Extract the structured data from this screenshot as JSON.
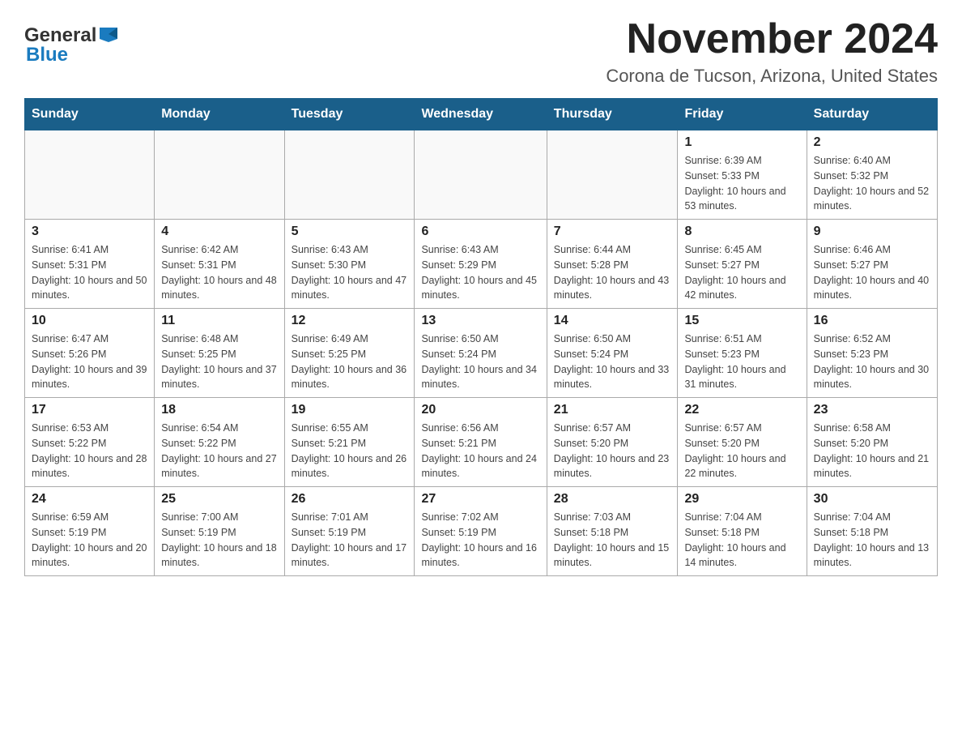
{
  "header": {
    "logo_general": "General",
    "logo_blue": "Blue",
    "month_title": "November 2024",
    "location": "Corona de Tucson, Arizona, United States"
  },
  "days_of_week": [
    "Sunday",
    "Monday",
    "Tuesday",
    "Wednesday",
    "Thursday",
    "Friday",
    "Saturday"
  ],
  "weeks": [
    [
      {
        "day": "",
        "info": ""
      },
      {
        "day": "",
        "info": ""
      },
      {
        "day": "",
        "info": ""
      },
      {
        "day": "",
        "info": ""
      },
      {
        "day": "",
        "info": ""
      },
      {
        "day": "1",
        "info": "Sunrise: 6:39 AM\nSunset: 5:33 PM\nDaylight: 10 hours and 53 minutes."
      },
      {
        "day": "2",
        "info": "Sunrise: 6:40 AM\nSunset: 5:32 PM\nDaylight: 10 hours and 52 minutes."
      }
    ],
    [
      {
        "day": "3",
        "info": "Sunrise: 6:41 AM\nSunset: 5:31 PM\nDaylight: 10 hours and 50 minutes."
      },
      {
        "day": "4",
        "info": "Sunrise: 6:42 AM\nSunset: 5:31 PM\nDaylight: 10 hours and 48 minutes."
      },
      {
        "day": "5",
        "info": "Sunrise: 6:43 AM\nSunset: 5:30 PM\nDaylight: 10 hours and 47 minutes."
      },
      {
        "day": "6",
        "info": "Sunrise: 6:43 AM\nSunset: 5:29 PM\nDaylight: 10 hours and 45 minutes."
      },
      {
        "day": "7",
        "info": "Sunrise: 6:44 AM\nSunset: 5:28 PM\nDaylight: 10 hours and 43 minutes."
      },
      {
        "day": "8",
        "info": "Sunrise: 6:45 AM\nSunset: 5:27 PM\nDaylight: 10 hours and 42 minutes."
      },
      {
        "day": "9",
        "info": "Sunrise: 6:46 AM\nSunset: 5:27 PM\nDaylight: 10 hours and 40 minutes."
      }
    ],
    [
      {
        "day": "10",
        "info": "Sunrise: 6:47 AM\nSunset: 5:26 PM\nDaylight: 10 hours and 39 minutes."
      },
      {
        "day": "11",
        "info": "Sunrise: 6:48 AM\nSunset: 5:25 PM\nDaylight: 10 hours and 37 minutes."
      },
      {
        "day": "12",
        "info": "Sunrise: 6:49 AM\nSunset: 5:25 PM\nDaylight: 10 hours and 36 minutes."
      },
      {
        "day": "13",
        "info": "Sunrise: 6:50 AM\nSunset: 5:24 PM\nDaylight: 10 hours and 34 minutes."
      },
      {
        "day": "14",
        "info": "Sunrise: 6:50 AM\nSunset: 5:24 PM\nDaylight: 10 hours and 33 minutes."
      },
      {
        "day": "15",
        "info": "Sunrise: 6:51 AM\nSunset: 5:23 PM\nDaylight: 10 hours and 31 minutes."
      },
      {
        "day": "16",
        "info": "Sunrise: 6:52 AM\nSunset: 5:23 PM\nDaylight: 10 hours and 30 minutes."
      }
    ],
    [
      {
        "day": "17",
        "info": "Sunrise: 6:53 AM\nSunset: 5:22 PM\nDaylight: 10 hours and 28 minutes."
      },
      {
        "day": "18",
        "info": "Sunrise: 6:54 AM\nSunset: 5:22 PM\nDaylight: 10 hours and 27 minutes."
      },
      {
        "day": "19",
        "info": "Sunrise: 6:55 AM\nSunset: 5:21 PM\nDaylight: 10 hours and 26 minutes."
      },
      {
        "day": "20",
        "info": "Sunrise: 6:56 AM\nSunset: 5:21 PM\nDaylight: 10 hours and 24 minutes."
      },
      {
        "day": "21",
        "info": "Sunrise: 6:57 AM\nSunset: 5:20 PM\nDaylight: 10 hours and 23 minutes."
      },
      {
        "day": "22",
        "info": "Sunrise: 6:57 AM\nSunset: 5:20 PM\nDaylight: 10 hours and 22 minutes."
      },
      {
        "day": "23",
        "info": "Sunrise: 6:58 AM\nSunset: 5:20 PM\nDaylight: 10 hours and 21 minutes."
      }
    ],
    [
      {
        "day": "24",
        "info": "Sunrise: 6:59 AM\nSunset: 5:19 PM\nDaylight: 10 hours and 20 minutes."
      },
      {
        "day": "25",
        "info": "Sunrise: 7:00 AM\nSunset: 5:19 PM\nDaylight: 10 hours and 18 minutes."
      },
      {
        "day": "26",
        "info": "Sunrise: 7:01 AM\nSunset: 5:19 PM\nDaylight: 10 hours and 17 minutes."
      },
      {
        "day": "27",
        "info": "Sunrise: 7:02 AM\nSunset: 5:19 PM\nDaylight: 10 hours and 16 minutes."
      },
      {
        "day": "28",
        "info": "Sunrise: 7:03 AM\nSunset: 5:18 PM\nDaylight: 10 hours and 15 minutes."
      },
      {
        "day": "29",
        "info": "Sunrise: 7:04 AM\nSunset: 5:18 PM\nDaylight: 10 hours and 14 minutes."
      },
      {
        "day": "30",
        "info": "Sunrise: 7:04 AM\nSunset: 5:18 PM\nDaylight: 10 hours and 13 minutes."
      }
    ]
  ]
}
